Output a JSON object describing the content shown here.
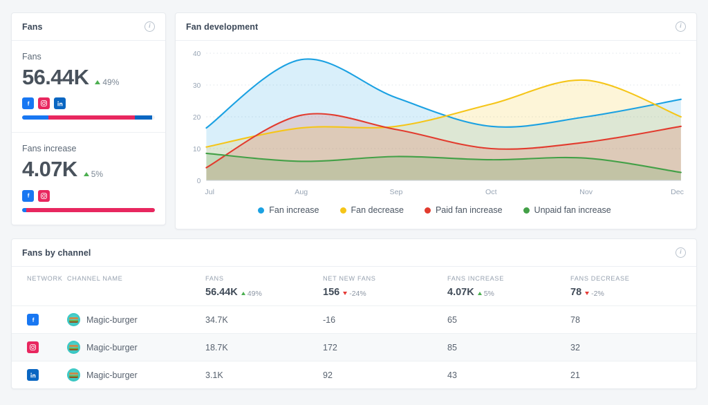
{
  "colors": {
    "facebook": "#1877f2",
    "instagram": "#e8275f",
    "linkedin": "#0a66c2",
    "fan_increase": "#1ba1e2",
    "fan_decrease": "#f5c518",
    "paid_fan_increase": "#e23b2e",
    "unpaid_fan_increase": "#43a047",
    "positive": "#4caf50",
    "negative": "#e53935"
  },
  "fans_card": {
    "title": "Fans",
    "info_icon": "info-icon",
    "blocks": [
      {
        "label": "Fans",
        "value": "56.44K",
        "delta": "49%",
        "delta_dir": "up",
        "networks": [
          "facebook",
          "instagram",
          "linkedin"
        ],
        "bar": [
          {
            "network": "facebook",
            "pct": 20
          },
          {
            "network": "instagram",
            "pct": 65
          },
          {
            "network": "linkedin",
            "pct": 13
          }
        ]
      },
      {
        "label": "Fans increase",
        "value": "4.07K",
        "delta": "5%",
        "delta_dir": "up",
        "networks": [
          "facebook",
          "instagram"
        ],
        "bar": [
          {
            "network": "facebook",
            "pct": 3
          },
          {
            "network": "instagram",
            "pct": 97
          }
        ]
      }
    ]
  },
  "chart_card": {
    "title": "Fan development",
    "info_icon": "info-icon"
  },
  "chart_data": {
    "type": "area",
    "title": "Fan development",
    "xlabel": "",
    "ylabel": "",
    "ylim": [
      0,
      40
    ],
    "yticks": [
      0,
      10,
      20,
      30,
      40
    ],
    "grid": true,
    "legend_position": "bottom",
    "categories": [
      "Jul",
      "Aug",
      "Sep",
      "Oct",
      "Nov",
      "Dec"
    ],
    "x": [
      0,
      1,
      2,
      3,
      4,
      5
    ],
    "series": [
      {
        "name": "Fan increase",
        "color": "#1ba1e2",
        "values": [
          16.5,
          38,
          26,
          17,
          20,
          25.5
        ]
      },
      {
        "name": "Fan decrease",
        "color": "#f5c518",
        "values": [
          10.5,
          16.5,
          17,
          24,
          31.5,
          20
        ]
      },
      {
        "name": "Paid fan increase",
        "color": "#e23b2e",
        "values": [
          4,
          20.5,
          16,
          10,
          12,
          17
        ]
      },
      {
        "name": "Unpaid fan increase",
        "color": "#43a047",
        "values": [
          8.5,
          6,
          7.5,
          6.5,
          7,
          2.5
        ]
      }
    ]
  },
  "legend": [
    {
      "label": "Fan increase",
      "color": "#1ba1e2"
    },
    {
      "label": "Fan decrease",
      "color": "#f5c518"
    },
    {
      "label": "Paid fan increase",
      "color": "#e23b2e"
    },
    {
      "label": "Unpaid fan increase",
      "color": "#43a047"
    }
  ],
  "table_card": {
    "title": "Fans by channel",
    "info_icon": "info-icon",
    "columns": [
      {
        "label": "NETWORK",
        "total": "",
        "delta": "",
        "delta_dir": ""
      },
      {
        "label": "CHANNEL NAME",
        "total": "",
        "delta": "",
        "delta_dir": ""
      },
      {
        "label": "FANS",
        "total": "56.44K",
        "delta": "49%",
        "delta_dir": "up"
      },
      {
        "label": "NET NEW FANS",
        "total": "156",
        "delta": "-24%",
        "delta_dir": "down"
      },
      {
        "label": "FANS INCREASE",
        "total": "4.07K",
        "delta": "5%",
        "delta_dir": "up"
      },
      {
        "label": "FANS DECREASE",
        "total": "78",
        "delta": "-2%",
        "delta_dir": "down"
      }
    ],
    "rows": [
      {
        "network": "facebook",
        "channel": "Magic-burger",
        "fans": "34.7K",
        "net_new_fans": "-16",
        "fans_increase": "65",
        "fans_decrease": "78"
      },
      {
        "network": "instagram",
        "channel": "Magic-burger",
        "fans": "18.7K",
        "net_new_fans": "172",
        "fans_increase": "85",
        "fans_decrease": "32"
      },
      {
        "network": "linkedin",
        "channel": "Magic-burger",
        "fans": "3.1K",
        "net_new_fans": "92",
        "fans_increase": "43",
        "fans_decrease": "21"
      }
    ]
  }
}
